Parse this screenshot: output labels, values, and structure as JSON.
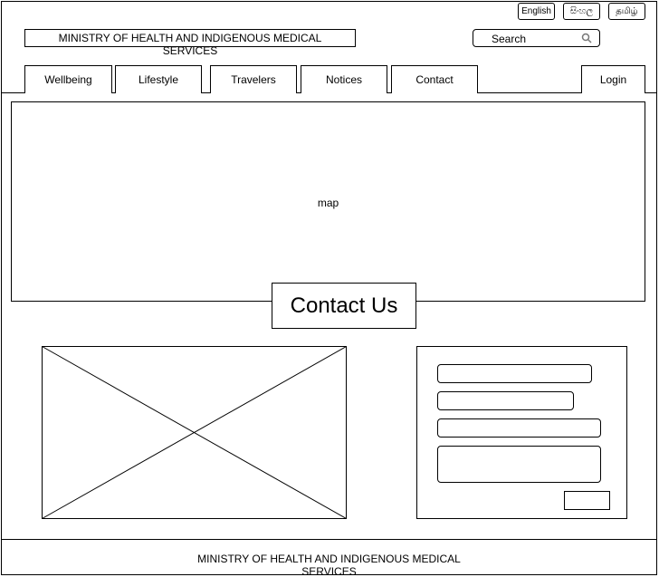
{
  "header": {
    "languages": [
      "English",
      "සිංහල",
      "தமிழ்"
    ],
    "title": "MINISTRY OF HEALTH AND INDIGENOUS MEDICAL SERVICES",
    "search": {
      "label": "Search",
      "icon": "search-icon"
    }
  },
  "nav": {
    "tabs": [
      {
        "label": "Wellbeing"
      },
      {
        "label": "Lifestyle"
      },
      {
        "label": "Travelers"
      },
      {
        "label": "Notices"
      },
      {
        "label": "Contact"
      }
    ],
    "login_label": "Login"
  },
  "main": {
    "map_label": "map",
    "contact_heading": "Contact Us"
  },
  "footer": {
    "text": "MINISTRY OF HEALTH AND INDIGENOUS MEDICAL SERVICES"
  }
}
